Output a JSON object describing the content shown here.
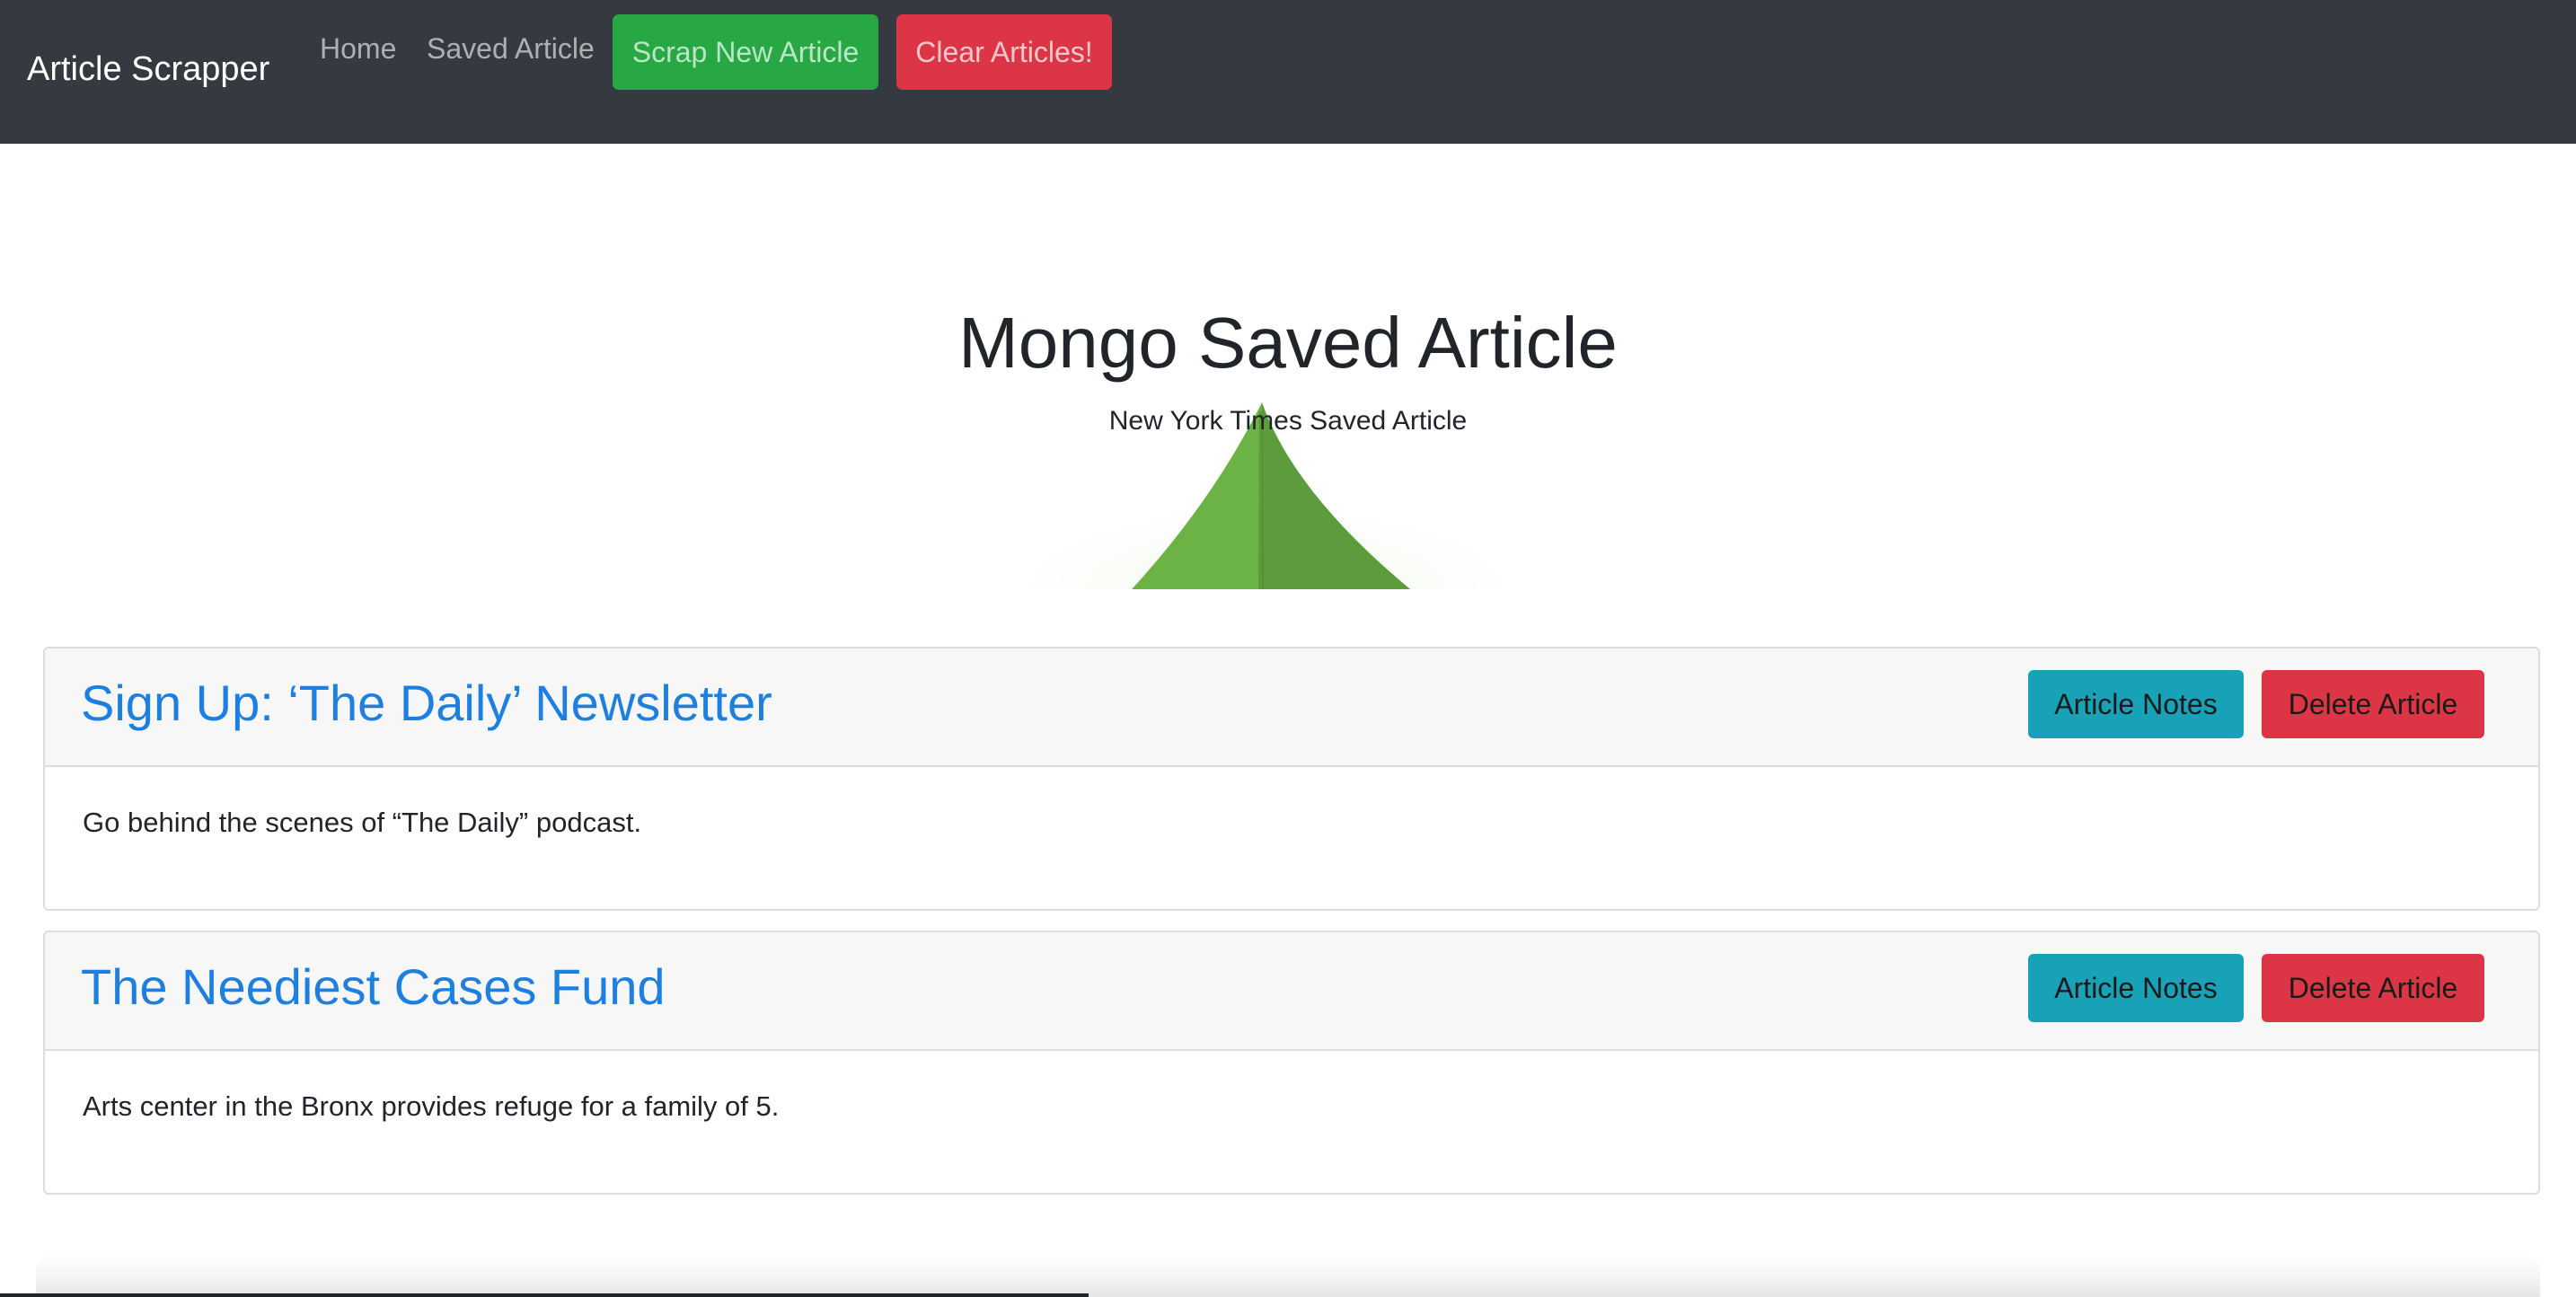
{
  "navbar": {
    "brand": "Article Scrapper",
    "links": [
      {
        "label": "Home"
      },
      {
        "label": "Saved Article"
      }
    ],
    "scrap_button": "Scrap New Article",
    "clear_button": "Clear Articles!"
  },
  "hero": {
    "title": "Mongo Saved Article",
    "subtitle": "New York Times Saved Article",
    "image": "mongodb-leaf-logo"
  },
  "articles": [
    {
      "title": "Sign Up: ‘The Daily’ Newsletter",
      "summary": "Go behind the scenes of “The Daily” podcast.",
      "notes_button": "Article Notes",
      "delete_button": "Delete Article"
    },
    {
      "title": "The Neediest Cases Fund",
      "summary": "Arts center in the Bronx provides refuge for a family of 5.",
      "notes_button": "Article Notes",
      "delete_button": "Delete Article"
    }
  ],
  "colors": {
    "navbar": "#343a40",
    "success": "#28a745",
    "danger": "#dc3545",
    "info": "#17a2b8",
    "link": "#1d7fe0"
  }
}
